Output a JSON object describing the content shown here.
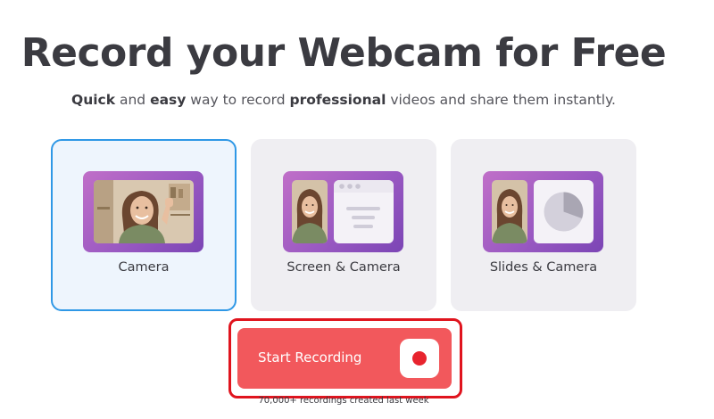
{
  "hero": {
    "title": "Record your Webcam for Free",
    "subtitle_parts": [
      "Quick",
      " and ",
      "easy",
      " way to record ",
      "professional",
      " videos and share them instantly."
    ]
  },
  "modes": [
    {
      "label": "Camera",
      "selected": true,
      "icon": "webcam-person-thumbnail"
    },
    {
      "label": "Screen & Camera",
      "selected": false,
      "icon": "screen-and-camera-thumbnail"
    },
    {
      "label": "Slides & Camera",
      "selected": false,
      "icon": "slides-and-camera-thumbnail"
    }
  ],
  "cta": {
    "label": "Start Recording",
    "icon": "record-dot-icon",
    "footnote": "70,000+ recordings created last week"
  },
  "colors": {
    "accent": "#f2585c",
    "selected_border": "#2f98e6",
    "highlight_frame": "#e0141e",
    "thumb_purple": "#9a59c2"
  }
}
